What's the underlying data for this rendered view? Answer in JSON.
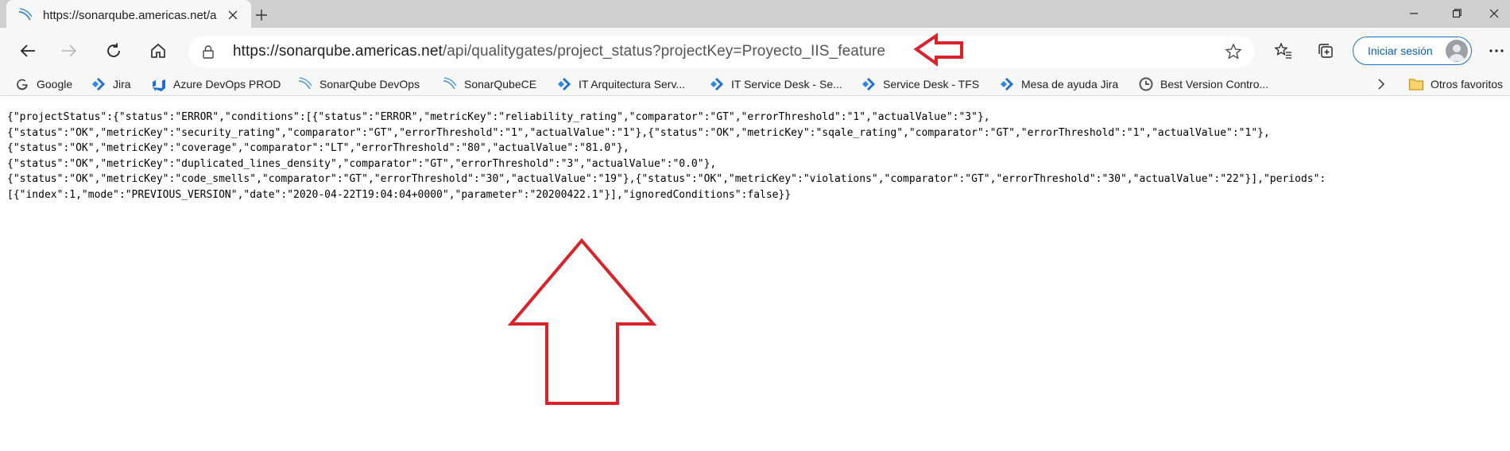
{
  "tab": {
    "title": "https://sonarqube.americas.net/a"
  },
  "address": {
    "host": "https://sonarqube.americas.net",
    "path": "/api/qualitygates/project_status?projectKey=Proyecto_IIS_feature"
  },
  "toolbar": {
    "signin_label": "Iniciar sesión"
  },
  "bookmarks": [
    {
      "label": "Google",
      "icon": "google-icon"
    },
    {
      "label": "Jira",
      "icon": "jira-icon"
    },
    {
      "label": "Azure DevOps PROD",
      "icon": "azure-devops-icon"
    },
    {
      "label": "SonarQube DevOps",
      "icon": "sonarqube-icon"
    },
    {
      "label": "SonarQubeCE",
      "icon": "sonarqube-icon"
    },
    {
      "label": "IT Arquitectura Serv...",
      "icon": "jira-icon"
    },
    {
      "label": "IT Service Desk - Se...",
      "icon": "jira-icon"
    },
    {
      "label": "Service Desk - TFS",
      "icon": "jira-icon"
    },
    {
      "label": "Mesa de ayuda Jira",
      "icon": "jira-icon"
    },
    {
      "label": "Best Version Contro...",
      "icon": "gitlab-icon"
    },
    {
      "label": "Otros favoritos",
      "icon": "folder-icon"
    }
  ],
  "content": {
    "lines": [
      "{\"projectStatus\":{\"status\":\"ERROR\",\"conditions\":[{\"status\":\"ERROR\",\"metricKey\":\"reliability_rating\",\"comparator\":\"GT\",\"errorThreshold\":\"1\",\"actualValue\":\"3\"},",
      "{\"status\":\"OK\",\"metricKey\":\"security_rating\",\"comparator\":\"GT\",\"errorThreshold\":\"1\",\"actualValue\":\"1\"},{\"status\":\"OK\",\"metricKey\":\"sqale_rating\",\"comparator\":\"GT\",\"errorThreshold\":\"1\",\"actualValue\":\"1\"},",
      "{\"status\":\"OK\",\"metricKey\":\"coverage\",\"comparator\":\"LT\",\"errorThreshold\":\"80\",\"actualValue\":\"81.0\"},",
      "{\"status\":\"OK\",\"metricKey\":\"duplicated_lines_density\",\"comparator\":\"GT\",\"errorThreshold\":\"3\",\"actualValue\":\"0.0\"},",
      "{\"status\":\"OK\",\"metricKey\":\"code_smells\",\"comparator\":\"GT\",\"errorThreshold\":\"30\",\"actualValue\":\"19\"},{\"status\":\"OK\",\"metricKey\":\"violations\",\"comparator\":\"GT\",\"errorThreshold\":\"30\",\"actualValue\":\"22\"}],\"periods\":",
      "[{\"index\":1,\"mode\":\"PREVIOUS_VERSION\",\"date\":\"2020-04-22T19:04:04+0000\",\"parameter\":\"20200422.1\"}],\"ignoredConditions\":false}}"
    ]
  },
  "colors": {
    "annotation_red": "#d9222a",
    "accent": "#1a73c8"
  }
}
